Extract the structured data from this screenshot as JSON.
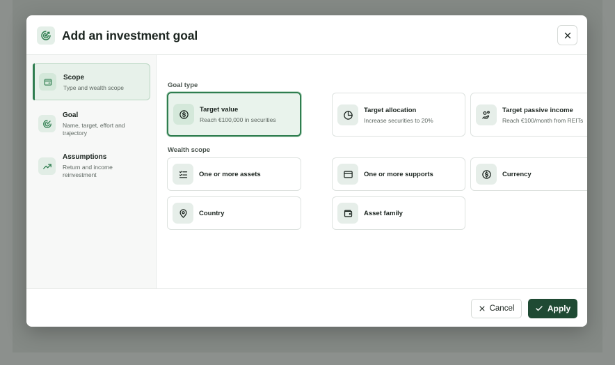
{
  "modal": {
    "title": "Add an investment goal"
  },
  "steps": [
    {
      "title": "Scope",
      "subtitle": "Type and wealth scope",
      "icon": "wallet-icon",
      "active": true
    },
    {
      "title": "Goal",
      "subtitle": "Name, target, effort and trajectory",
      "icon": "target-icon",
      "active": false
    },
    {
      "title": "Assumptions",
      "subtitle": "Return and income reinvestment",
      "icon": "trend-up-icon",
      "active": false
    }
  ],
  "goal_type": {
    "label": "Goal type",
    "options": [
      {
        "title": "Target value",
        "subtitle": "Reach €100,000 in securities",
        "icon": "dollar-circle-icon",
        "selected": true
      },
      {
        "title": "Target allocation",
        "subtitle": "Increase securities to 20%",
        "icon": "pie-chart-icon",
        "selected": false
      },
      {
        "title": "Target passive income",
        "subtitle": "Reach €100/month from REITs",
        "icon": "hand-coins-icon",
        "selected": false
      }
    ]
  },
  "wealth_scope": {
    "label": "Wealth scope",
    "options": [
      {
        "title": "One or more assets",
        "icon": "list-check-icon"
      },
      {
        "title": "One or more supports",
        "icon": "card-icon"
      },
      {
        "title": "Currency",
        "icon": "dollar-circle-icon"
      },
      {
        "title": "Country",
        "icon": "map-pin-icon"
      },
      {
        "title": "Asset family",
        "icon": "wallet-icon"
      }
    ]
  },
  "footer": {
    "cancel_label": "Cancel",
    "apply_label": "Apply"
  },
  "colors": {
    "accent": "#2e7d4f",
    "primary_button": "#1f4a33",
    "selected_bg": "#e9f3ec"
  }
}
